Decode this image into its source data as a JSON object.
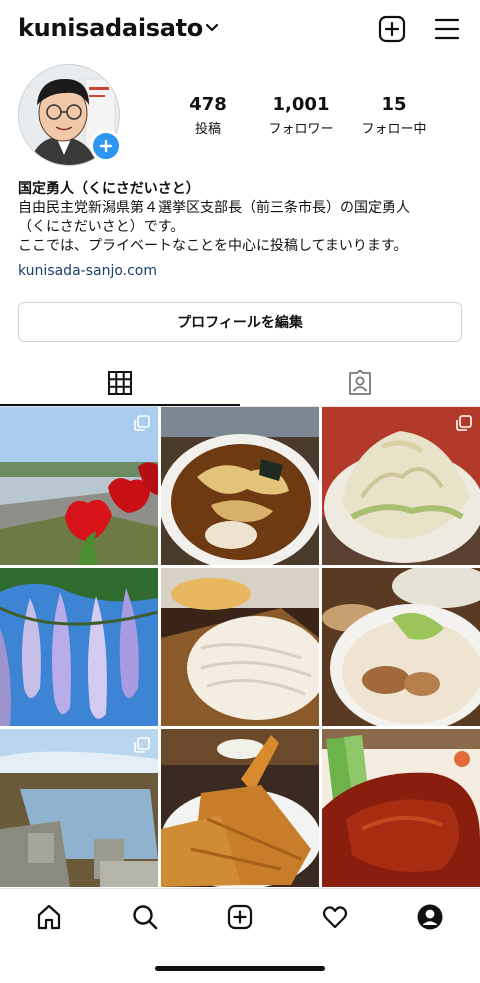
{
  "header": {
    "username": "kunisadaisato",
    "icons": [
      "chevron-down-icon",
      "new-post-icon",
      "menu-icon"
    ]
  },
  "stats": [
    {
      "value": "478",
      "label": "投稿"
    },
    {
      "value": "1,001",
      "label": "フォロワー"
    },
    {
      "value": "15",
      "label": "フォロー中"
    }
  ],
  "bio": {
    "name": "国定勇人（くにさだいさと）",
    "line1": "自由民主党新潟県第４選挙区支部長（前三条市長）の国定勇人",
    "line2": "（くにさだいさと）です。",
    "line3": "ここでは、プライベートなことを中心に投稿してまいります。",
    "link": "kunisada-sanjo.com"
  },
  "edit_profile_label": "プロフィールを編集",
  "tabs": [
    "grid-icon",
    "tagged-icon"
  ],
  "colors": {
    "accent": "#2f95f3",
    "link": "#1d3f6e"
  },
  "posts": [
    {
      "subject": "tulips-riverbank",
      "multi": true
    },
    {
      "subject": "ramen-shoyu",
      "multi": false
    },
    {
      "subject": "ramen-bean-sprouts",
      "multi": true
    },
    {
      "subject": "wisteria",
      "multi": false
    },
    {
      "subject": "zaru-udon",
      "multi": false
    },
    {
      "subject": "ramen-tonkotsu",
      "multi": false
    },
    {
      "subject": "water-channel-field",
      "multi": true
    },
    {
      "subject": "fried-shrimp-cutlet",
      "multi": false
    },
    {
      "subject": "katsu-curry",
      "multi": false
    }
  ],
  "bottom_nav": [
    "home-icon",
    "search-icon",
    "create-icon",
    "activity-icon",
    "profile-icon"
  ]
}
